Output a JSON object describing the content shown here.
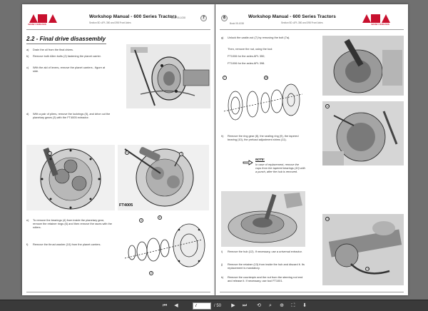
{
  "document": {
    "header_title": "Workshop Manual - 600 Series Tractors",
    "left_page": {
      "page_badge": "7",
      "subheader": "Section 5D: APL 350 and 398 Front Axles",
      "code": "Book 05-1038",
      "logo_text": "MASSEY FERGUSON",
      "section_title": "2.2 - Final drive disassembly",
      "steps": [
        {
          "letter": "a)",
          "text": "Drain the oil from the final drives."
        },
        {
          "letter": "b)",
          "text": "Remove both Allen bolts (2) fastening the planet carrier."
        },
        {
          "letter": "c)",
          "text": "With the aid of levers, remove the planet carriers - figure at side."
        },
        {
          "letter": "d)",
          "text": "With a pair of pliers, remove the lockrings (5), and drive out the planetary gears (3) with the FT4005 extractor."
        },
        {
          "letter": "e)",
          "text": "To remove the bearings (4) from inside the planetary gear, remove the retainer rings (6) and then remove the races with the rollers."
        },
        {
          "letter": "f)",
          "text": "Remove the thrust washer (10) from the planet carriers."
        }
      ],
      "tool_label": "FT4005"
    },
    "right_page": {
      "page_badge": "8",
      "subheader": "Section 5D: APL 350 and 398 Front Axles",
      "code": "Book 05-1038",
      "logo_text": "MASSEY FERGUSON",
      "steps_top": [
        {
          "letter": "g)",
          "text": "Unlock the castle-nut (7) by removing the bolt (7a)."
        },
        {
          "letter": "",
          "text": "Then, remove the nut, using the tool:"
        },
        {
          "letter": "",
          "text": "FT1006 for the axles APL 350;"
        },
        {
          "letter": "",
          "text": "FT1006 for the axles APL 398."
        },
        {
          "letter": "h)",
          "text": "Remove the ring gear (8), the sealing ring (9), the tapered bearing (10), the preload adjustment shims (11)."
        }
      ],
      "note_label": "NOTE:",
      "note_text": "In case of replacement, remove the cups from the tapered bearings (10) with a punch, after the hub is removed.",
      "steps_bottom": [
        {
          "letter": "i)",
          "text": "Remove the hub (12). If necessary, use a universal extractor."
        },
        {
          "letter": "j)",
          "text": "Remove the retainer (13) from inside the hub and discard it. Its replacement is mandatory."
        },
        {
          "letter": "k)",
          "text": "Remove the counterpin and the nut from the steering rod end and release it. If necessary, use tool FT1001."
        }
      ]
    }
  },
  "callouts": {
    "c2": "2",
    "c3": "3",
    "c4": "4",
    "c5": "5",
    "c6": "6",
    "c7": "7",
    "c10": "10",
    "c12": "12",
    "c13": "13",
    "c14": "14"
  },
  "toolbar": {
    "first_icon": "first-page-icon",
    "prev_icon": "prev-page-icon",
    "current_page": "7",
    "total_pages": "/ 50",
    "next_icon": "next-page-icon",
    "last_icon": "last-page-icon",
    "extra_icons": [
      "rotate-icon",
      "search-icon",
      "zoom-icon",
      "fit-icon",
      "download-icon"
    ]
  },
  "colors": {
    "brand_red": "#c8102e",
    "viewer_bg": "#707070",
    "toolbar_bg": "#3a3a3a"
  }
}
